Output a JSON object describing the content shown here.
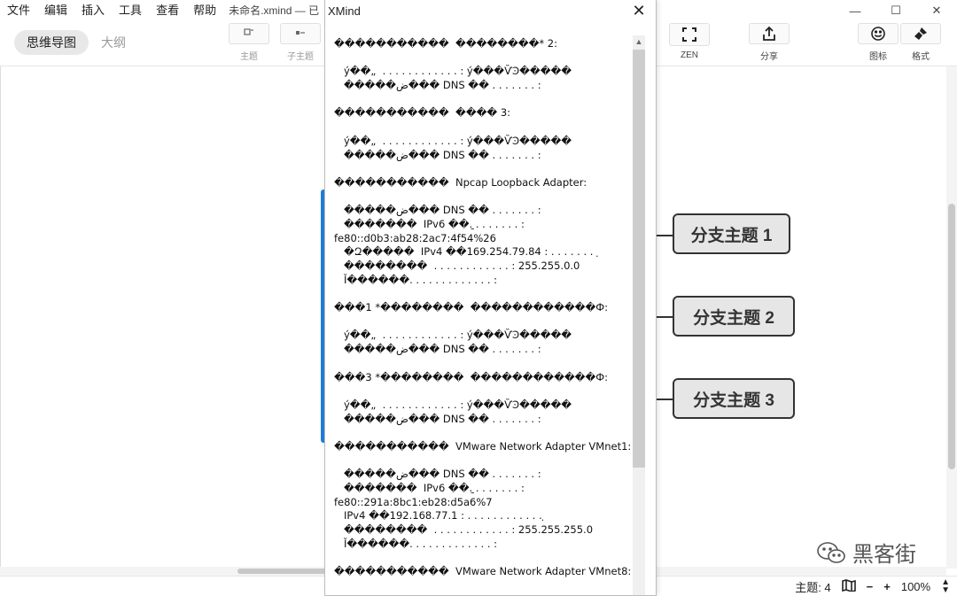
{
  "app": {
    "menu": [
      "文件",
      "编辑",
      "插入",
      "工具",
      "查看",
      "帮助"
    ],
    "doc_title": "未命名.xmind — 已",
    "window_controls": {
      "minimize": "—",
      "maximize": "☐",
      "close": "✕"
    }
  },
  "toolbar": {
    "views": [
      {
        "label": "思维导图",
        "active": true
      },
      {
        "label": "大纲",
        "active": false
      }
    ],
    "buttons": {
      "topic": {
        "label": "主题",
        "icon": "topic-icon"
      },
      "subtopic": {
        "label": "子主题",
        "icon": "subtopic-icon"
      },
      "zen": {
        "label": "ZEN",
        "icon": "fullscreen-icon"
      },
      "share": {
        "label": "分享",
        "icon": "share-icon"
      },
      "icons": {
        "label": "图标",
        "icon": "emoji-icon"
      },
      "format": {
        "label": "格式",
        "icon": "brush-icon"
      }
    }
  },
  "canvas": {
    "branches": [
      "分支主题 1",
      "分支主题 2",
      "分支主题 3"
    ]
  },
  "popup": {
    "title": "XMind",
    "close": "✕",
    "lines": [
      "�����������  ��������* 2:",
      "",
      "   ý��„  . . . . . . . . . . . . : ý���ѶϿ�����",
      "   �����ض��� DNS ��׺ . . . . . . . :",
      "",
      "�����������  ���� 3:",
      "",
      "   ý��„  . . . . . . . . . . . . : ý���ѶϿ�����",
      "   �����ض��� DNS ��׺ . . . . . . . :",
      "",
      "�����������  Npcap Loopback Adapter:",
      "",
      "   �����ض��� DNS ��׺ . . . . . . . :",
      "   �������  IPv6 ��ַ. . . . . . . . :",
      "fe80::d0b3:ab28:2ac7:4f54%26",
      "   �Զ�����  IPv4 ��169.254.79.84 : . . . . . . .  ̣",
      "   ��������  . . . . . . . . . . . . : 255.255.0.0",
      "   Ĭ������. . . . . . . . . . . . . :",
      "",
      "���1 *��������  ������������Ф:",
      "",
      "   ý��„  . . . . . . . . . . . . : ý���ѶϿ�����",
      "   �����ض��� DNS ��׺ . . . . . . . :",
      "",
      "���3 *��������  ������������Ф:",
      "",
      "   ý��„  . . . . . . . . . . . . : ý���ѶϿ�����",
      "   �����ض��� DNS ��׺ . . . . . . . :",
      "",
      "�����������  VMware Network Adapter VMnet1:",
      "",
      "   �����ض��� DNS ��׺ . . . . . . . :",
      "   �������  IPv6 ��ַ. . . . . . . . :",
      "fe80::291a:8bc1:eb28:d5a6%7",
      "   IPv4 ��192.168.77.1 : . . . . . . . . . . . . ̣",
      "   ��������  . . . . . . . . . . . . : 255.255.255.0",
      "   Ĭ������. . . . . . . . . . . . . :",
      "",
      "�����������  VMware Network Adapter VMnet8:"
    ]
  },
  "statusbar": {
    "topic_count": "主题: 4",
    "zoom_out": "−",
    "zoom_in": "+",
    "zoom": "100%"
  },
  "watermark": {
    "text": "黑客街"
  },
  "colors": {
    "accent_blue": "#1f7dd8",
    "topic_fill": "#e6e6e6",
    "topic_border": "#333333"
  }
}
